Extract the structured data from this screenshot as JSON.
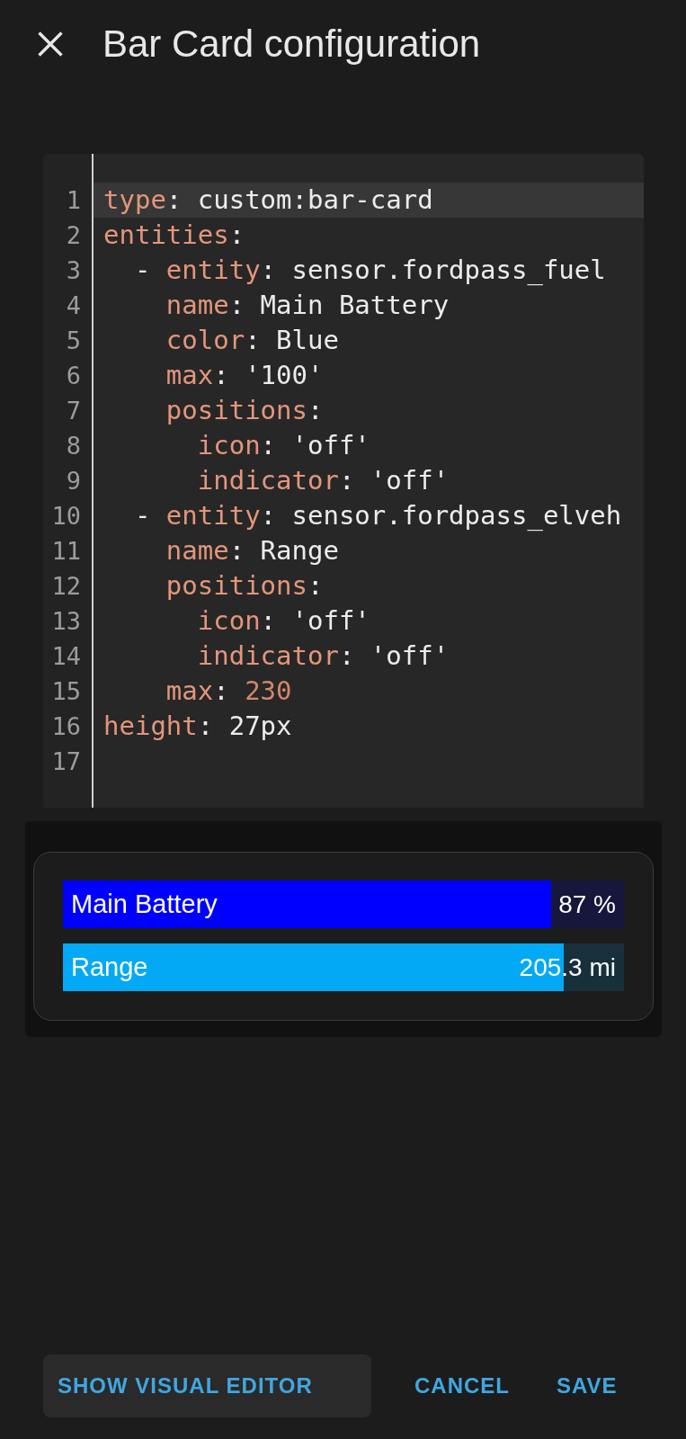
{
  "dialog": {
    "title": "Bar Card configuration"
  },
  "editor": {
    "lines": [
      {
        "number": "1",
        "active": true,
        "tokens": [
          {
            "kind": "key",
            "text": "type"
          },
          {
            "kind": "plain",
            "text": ": custom:bar-card"
          }
        ]
      },
      {
        "number": "2",
        "active": false,
        "tokens": [
          {
            "kind": "key",
            "text": "entities"
          },
          {
            "kind": "plain",
            "text": ":"
          }
        ]
      },
      {
        "number": "3",
        "active": false,
        "tokens": [
          {
            "kind": "plain",
            "text": "  - "
          },
          {
            "kind": "key",
            "text": "entity"
          },
          {
            "kind": "plain",
            "text": ": sensor.fordpass_fuel"
          }
        ]
      },
      {
        "number": "4",
        "active": false,
        "tokens": [
          {
            "kind": "key",
            "text": "    name"
          },
          {
            "kind": "plain",
            "text": ": Main Battery"
          }
        ]
      },
      {
        "number": "5",
        "active": false,
        "tokens": [
          {
            "kind": "key",
            "text": "    color"
          },
          {
            "kind": "plain",
            "text": ": Blue"
          }
        ]
      },
      {
        "number": "6",
        "active": false,
        "tokens": [
          {
            "kind": "key",
            "text": "    max"
          },
          {
            "kind": "plain",
            "text": ": '100'"
          }
        ]
      },
      {
        "number": "7",
        "active": false,
        "tokens": [
          {
            "kind": "key",
            "text": "    positions"
          },
          {
            "kind": "plain",
            "text": ":"
          }
        ]
      },
      {
        "number": "8",
        "active": false,
        "tokens": [
          {
            "kind": "key",
            "text": "      icon"
          },
          {
            "kind": "plain",
            "text": ": 'off'"
          }
        ]
      },
      {
        "number": "9",
        "active": false,
        "tokens": [
          {
            "kind": "key",
            "text": "      indicator"
          },
          {
            "kind": "plain",
            "text": ": 'off'"
          }
        ]
      },
      {
        "number": "10",
        "active": false,
        "tokens": [
          {
            "kind": "plain",
            "text": "  - "
          },
          {
            "kind": "key",
            "text": "entity"
          },
          {
            "kind": "plain",
            "text": ": sensor.fordpass_elveh"
          }
        ]
      },
      {
        "number": "11",
        "active": false,
        "tokens": [
          {
            "kind": "key",
            "text": "    name"
          },
          {
            "kind": "plain",
            "text": ": Range"
          }
        ]
      },
      {
        "number": "12",
        "active": false,
        "tokens": [
          {
            "kind": "key",
            "text": "    positions"
          },
          {
            "kind": "plain",
            "text": ":"
          }
        ]
      },
      {
        "number": "13",
        "active": false,
        "tokens": [
          {
            "kind": "key",
            "text": "      icon"
          },
          {
            "kind": "plain",
            "text": ": 'off'"
          }
        ]
      },
      {
        "number": "14",
        "active": false,
        "tokens": [
          {
            "kind": "key",
            "text": "      indicator"
          },
          {
            "kind": "plain",
            "text": ": 'off'"
          }
        ]
      },
      {
        "number": "15",
        "active": false,
        "tokens": [
          {
            "kind": "key",
            "text": "    max"
          },
          {
            "kind": "plain",
            "text": ": "
          },
          {
            "kind": "number",
            "text": "230"
          }
        ]
      },
      {
        "number": "16",
        "active": false,
        "tokens": [
          {
            "kind": "key",
            "text": "height"
          },
          {
            "kind": "plain",
            "text": ": 27px"
          }
        ]
      },
      {
        "number": "17",
        "active": false
      }
    ]
  },
  "preview": {
    "bars": [
      {
        "name": "Main Battery",
        "value": "87 %",
        "level": 0.87,
        "color": "#0000ff"
      },
      {
        "name": "Range",
        "value": "205.3 mi",
        "level": 0.893,
        "color": "#03a9f4"
      }
    ]
  },
  "actions": [
    {
      "label": "SHOW VISUAL EDITOR",
      "kind": "filled"
    },
    {
      "label": "CANCEL",
      "kind": "text"
    },
    {
      "label": "SAVE",
      "kind": "text"
    }
  ]
}
